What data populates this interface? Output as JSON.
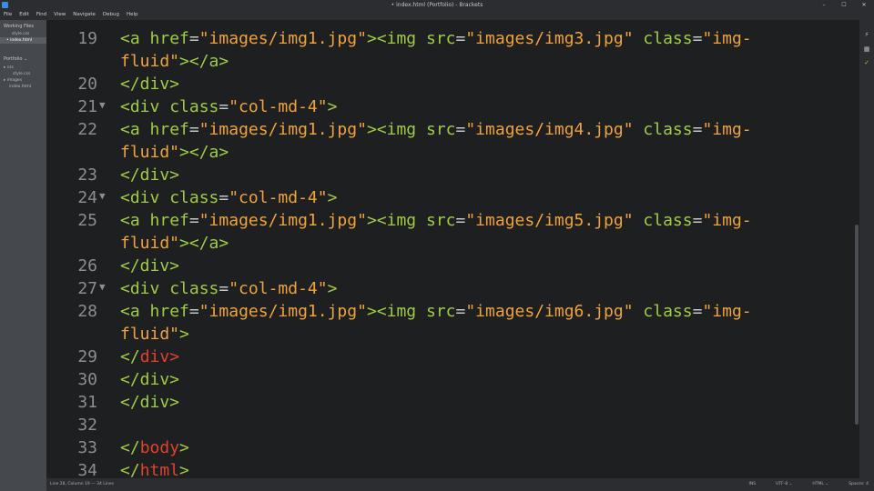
{
  "window": {
    "title": "• index.html (Portfolio) - Brackets",
    "controls": [
      "–",
      "☐",
      "✕"
    ]
  },
  "menu": [
    "File",
    "Edit",
    "Find",
    "View",
    "Navigate",
    "Debug",
    "Help"
  ],
  "sidebar": {
    "working_files_title": "Working Files",
    "working_files": [
      {
        "name": "style.css",
        "active": false
      },
      {
        "name": "• index.html",
        "active": true
      }
    ],
    "project_title": "Portfolio ⌄",
    "tree": [
      "▸ css",
      "style.css",
      "▸ images",
      "index.html"
    ]
  },
  "editor": {
    "lines": [
      {
        "num": "19",
        "fold": "",
        "tokens": [
          [
            "tag",
            "<a "
          ],
          [
            "attr",
            "href"
          ],
          [
            "eq",
            "="
          ],
          [
            "str",
            "\"images/img1.jpg\""
          ],
          [
            "tag",
            ">"
          ],
          [
            "tag",
            "<img "
          ],
          [
            "attr",
            "src"
          ],
          [
            "eq",
            "="
          ],
          [
            "str",
            "\"images/img3.jpg\""
          ],
          [
            "plain",
            " "
          ],
          [
            "attr",
            "class"
          ],
          [
            "eq",
            "="
          ],
          [
            "str",
            "\"img-"
          ]
        ]
      },
      {
        "num": "",
        "fold": "",
        "tokens": [
          [
            "str",
            "fluid\""
          ],
          [
            "tag",
            ">"
          ],
          [
            "tag",
            "</a>"
          ]
        ]
      },
      {
        "num": "20",
        "fold": "",
        "tokens": [
          [
            "tag",
            "</div>"
          ]
        ]
      },
      {
        "num": "21",
        "fold": "▼",
        "tokens": [
          [
            "tag",
            "<div "
          ],
          [
            "attr",
            "class"
          ],
          [
            "eq",
            "="
          ],
          [
            "str",
            "\"col-md-4\""
          ],
          [
            "tag",
            ">"
          ]
        ]
      },
      {
        "num": "22",
        "fold": "",
        "tokens": [
          [
            "tag",
            "<a "
          ],
          [
            "attr",
            "href"
          ],
          [
            "eq",
            "="
          ],
          [
            "str",
            "\"images/img1.jpg\""
          ],
          [
            "tag",
            ">"
          ],
          [
            "tag",
            "<img "
          ],
          [
            "attr",
            "src"
          ],
          [
            "eq",
            "="
          ],
          [
            "str",
            "\"images/img4.jpg\""
          ],
          [
            "plain",
            " "
          ],
          [
            "attr",
            "class"
          ],
          [
            "eq",
            "="
          ],
          [
            "str",
            "\"img-"
          ]
        ]
      },
      {
        "num": "",
        "fold": "",
        "tokens": [
          [
            "str",
            "fluid\""
          ],
          [
            "tag",
            ">"
          ],
          [
            "tag",
            "</a>"
          ]
        ]
      },
      {
        "num": "23",
        "fold": "",
        "tokens": [
          [
            "tag",
            "</div>"
          ]
        ]
      },
      {
        "num": "24",
        "fold": "▼",
        "tokens": [
          [
            "tag",
            "<div "
          ],
          [
            "attr",
            "class"
          ],
          [
            "eq",
            "="
          ],
          [
            "str",
            "\"col-md-4\""
          ],
          [
            "tag",
            ">"
          ]
        ]
      },
      {
        "num": "25",
        "fold": "",
        "tokens": [
          [
            "tag",
            "<a "
          ],
          [
            "attr",
            "href"
          ],
          [
            "eq",
            "="
          ],
          [
            "str",
            "\"images/img1.jpg\""
          ],
          [
            "tag",
            ">"
          ],
          [
            "tag",
            "<img "
          ],
          [
            "attr",
            "src"
          ],
          [
            "eq",
            "="
          ],
          [
            "str",
            "\"images/img5.jpg\""
          ],
          [
            "plain",
            " "
          ],
          [
            "attr",
            "class"
          ],
          [
            "eq",
            "="
          ],
          [
            "str",
            "\"img-"
          ]
        ]
      },
      {
        "num": "",
        "fold": "",
        "tokens": [
          [
            "str",
            "fluid\""
          ],
          [
            "tag",
            ">"
          ],
          [
            "tag",
            "</a>"
          ]
        ]
      },
      {
        "num": "26",
        "fold": "",
        "tokens": [
          [
            "tag",
            "</div>"
          ]
        ]
      },
      {
        "num": "27",
        "fold": "▼",
        "tokens": [
          [
            "tag",
            "<div "
          ],
          [
            "attr",
            "class"
          ],
          [
            "eq",
            "="
          ],
          [
            "str",
            "\"col-md-4\""
          ],
          [
            "tag",
            ">"
          ]
        ]
      },
      {
        "num": "28",
        "fold": "",
        "tokens": [
          [
            "tag",
            "<a "
          ],
          [
            "attr",
            "href"
          ],
          [
            "eq",
            "="
          ],
          [
            "str",
            "\"images/img1.jpg\""
          ],
          [
            "tag",
            ">"
          ],
          [
            "tag",
            "<img "
          ],
          [
            "attr",
            "src"
          ],
          [
            "eq",
            "="
          ],
          [
            "str",
            "\"images/img6.jpg\""
          ],
          [
            "plain",
            " "
          ],
          [
            "attr",
            "class"
          ],
          [
            "eq",
            "="
          ],
          [
            "str",
            "\"img-"
          ]
        ]
      },
      {
        "num": "",
        "fold": "",
        "tokens": [
          [
            "str",
            "fluid\""
          ],
          [
            "tag",
            ">"
          ]
        ]
      },
      {
        "num": "29",
        "fold": "",
        "tokens": [
          [
            "tag",
            "</"
          ],
          [
            "tag-red",
            "div"
          ],
          [
            "tag-red",
            ">"
          ]
        ]
      },
      {
        "num": "30",
        "fold": "",
        "tokens": [
          [
            "tag",
            "</div>"
          ]
        ]
      },
      {
        "num": "31",
        "fold": "",
        "tokens": [
          [
            "tag",
            "</div>"
          ]
        ]
      },
      {
        "num": "32",
        "fold": "",
        "tokens": []
      },
      {
        "num": "33",
        "fold": "",
        "tokens": [
          [
            "tag",
            "</"
          ],
          [
            "tag-red",
            "body"
          ],
          [
            "tag",
            "> "
          ]
        ]
      },
      {
        "num": "34",
        "fold": "",
        "tokens": [
          [
            "tag",
            "</"
          ],
          [
            "tag-red",
            "html"
          ],
          [
            "tag",
            ">"
          ]
        ]
      }
    ]
  },
  "status": {
    "cursor": "Line 28, Column 19 — 34 Lines",
    "ins": "INS",
    "encoding": "UTF-8 ⌄",
    "language": "HTML ⌄",
    "spaces": "Spaces: 4"
  },
  "colors": {
    "tag": "#9fcc46",
    "tag_error": "#e2412e",
    "string": "#f0a33c",
    "background": "#1d1f21"
  }
}
